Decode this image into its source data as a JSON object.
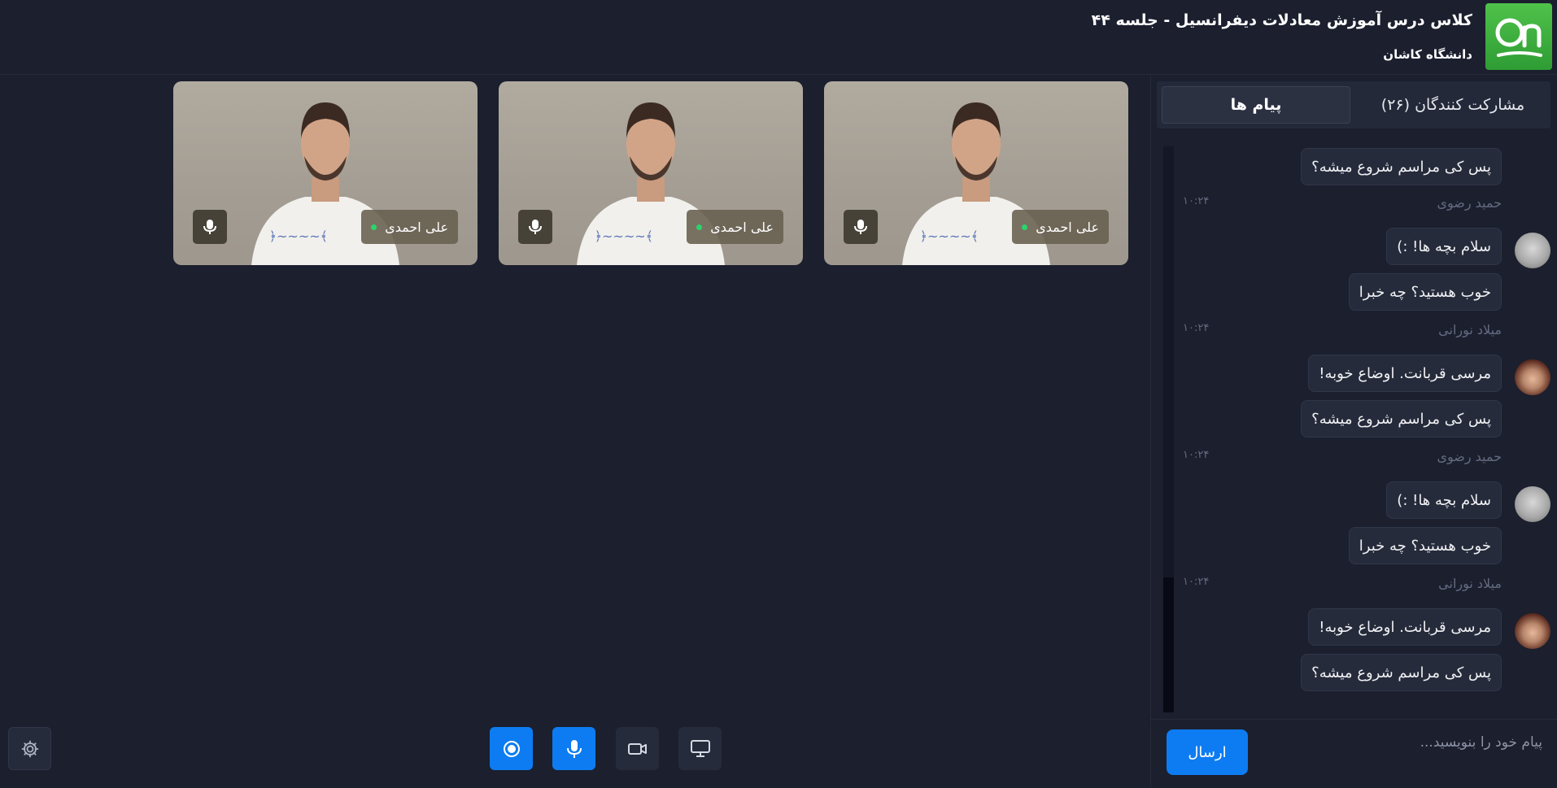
{
  "header": {
    "class_title": "کلاس درس آموزش معادلات دیفرانسیل - جلسه ۴۴",
    "university": "دانشگاه کاشان",
    "logo_text": "On",
    "logo_color": "#3aad3d"
  },
  "tabs": {
    "participants": "مشارکت کنندگان (۲۶)",
    "messages": "پیام ها",
    "active": "messages"
  },
  "chat": {
    "messages": [
      {
        "text": "پس کی مراسم شروع میشه؟"
      },
      {
        "sender": "حمید رضوی",
        "time": "۱۰:۲۴",
        "avatar": "hamid-avatar",
        "text": "سلام بچه ها! :)"
      },
      {
        "text": "خوب هستید؟ چه خبرا"
      },
      {
        "sender": "میلاد نورانی",
        "time": "۱۰:۲۴",
        "avatar": "milad-avatar",
        "text": "مرسی قربانت. اوضاع خوبه!"
      },
      {
        "text": "پس کی مراسم شروع میشه؟"
      },
      {
        "sender": "حمید رضوی",
        "time": "۱۰:۲۴",
        "avatar": "hamid-avatar",
        "text": "سلام بچه ها! :)"
      },
      {
        "text": "خوب هستید؟ چه خبرا"
      },
      {
        "sender": "میلاد نورانی",
        "time": "۱۰:۲۴",
        "avatar": "milad-avatar",
        "text": "مرسی قربانت. اوضاع خوبه!"
      },
      {
        "text": "پس کی مراسم شروع میشه؟"
      }
    ]
  },
  "composer": {
    "placeholder": "پیام خود را بنویسید...",
    "send_label": "ارسال"
  },
  "videos": [
    {
      "name": "علی احمدی",
      "status": "online",
      "mic_icon": "microphone-icon"
    },
    {
      "name": "علی احمدی",
      "status": "online",
      "mic_icon": "microphone-icon"
    },
    {
      "name": "علی احمدی",
      "status": "online",
      "mic_icon": "microphone-icon"
    }
  ],
  "controls": [
    {
      "name": "record",
      "icon": "record-icon",
      "active": true
    },
    {
      "name": "microphone",
      "icon": "microphone-icon",
      "active": true
    },
    {
      "name": "camera",
      "icon": "video-camera-icon",
      "active": false
    },
    {
      "name": "share-screen",
      "icon": "monitor-icon",
      "active": false
    }
  ],
  "settings": {
    "icon": "gear-icon"
  },
  "colors": {
    "background": "#1b1f2e",
    "accent": "#0d7cf2",
    "online": "#2bd46a",
    "bubble": "#262b3b"
  }
}
